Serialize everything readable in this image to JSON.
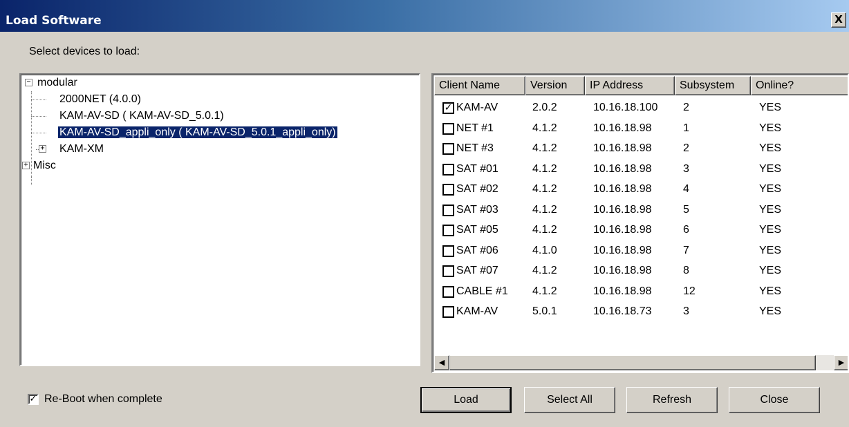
{
  "window": {
    "title": "Load Software",
    "close_symbol": "X"
  },
  "prompt": "Select devices to load:",
  "tree": {
    "nodes": [
      {
        "label": "modular",
        "expander": "−"
      },
      {
        "label": "2000NET (4.0.0)"
      },
      {
        "label": "KAM-AV-SD  ( KAM-AV-SD_5.0.1)"
      },
      {
        "label": "KAM-AV-SD_appli_only  ( KAM-AV-SD_5.0.1_appli_only)",
        "selected": true
      },
      {
        "label": "KAM-XM",
        "expander": "+"
      },
      {
        "label": "Misc",
        "expander": "+"
      }
    ]
  },
  "list": {
    "columns": [
      "Client Name",
      "Version",
      "IP Address",
      "Subsystem",
      "Online?"
    ],
    "rows": [
      {
        "checked": "✓",
        "name": "KAM-AV",
        "version": "2.0.2",
        "ip": "10.16.18.100",
        "subsystem": "2",
        "online": "YES"
      },
      {
        "checked": "",
        "name": "NET #1",
        "version": "4.1.2",
        "ip": "10.16.18.98",
        "subsystem": "1",
        "online": "YES"
      },
      {
        "checked": "",
        "name": "NET #3",
        "version": "4.1.2",
        "ip": "10.16.18.98",
        "subsystem": "2",
        "online": "YES"
      },
      {
        "checked": "",
        "name": "SAT #01",
        "version": "4.1.2",
        "ip": "10.16.18.98",
        "subsystem": "3",
        "online": "YES"
      },
      {
        "checked": "",
        "name": "SAT #02",
        "version": "4.1.2",
        "ip": "10.16.18.98",
        "subsystem": "4",
        "online": "YES"
      },
      {
        "checked": "",
        "name": "SAT #03",
        "version": "4.1.2",
        "ip": "10.16.18.98",
        "subsystem": "5",
        "online": "YES"
      },
      {
        "checked": "",
        "name": "SAT #05",
        "version": "4.1.2",
        "ip": "10.16.18.98",
        "subsystem": "6",
        "online": "YES"
      },
      {
        "checked": "",
        "name": "SAT #06",
        "version": "4.1.0",
        "ip": "10.16.18.98",
        "subsystem": "7",
        "online": "YES"
      },
      {
        "checked": "",
        "name": "SAT #07",
        "version": "4.1.2",
        "ip": "10.16.18.98",
        "subsystem": "8",
        "online": "YES"
      },
      {
        "checked": "",
        "name": "CABLE #1",
        "version": "4.1.2",
        "ip": "10.16.18.98",
        "subsystem": "12",
        "online": "YES"
      },
      {
        "checked": "",
        "name": "KAM-AV",
        "version": "5.0.1",
        "ip": "10.16.18.73",
        "subsystem": "3",
        "online": "YES"
      }
    ],
    "scroll_left": "◀",
    "scroll_right": "▶"
  },
  "reboot": {
    "checked": "✓",
    "label": "Re-Boot when complete"
  },
  "buttons": {
    "load": "Load",
    "select_all": "Select All",
    "refresh": "Refresh",
    "close": "Close"
  },
  "colors": {
    "selection": "#0a246a",
    "title_start": "#0a246a",
    "title_end": "#a6caf0",
    "face": "#d4d0c8"
  }
}
